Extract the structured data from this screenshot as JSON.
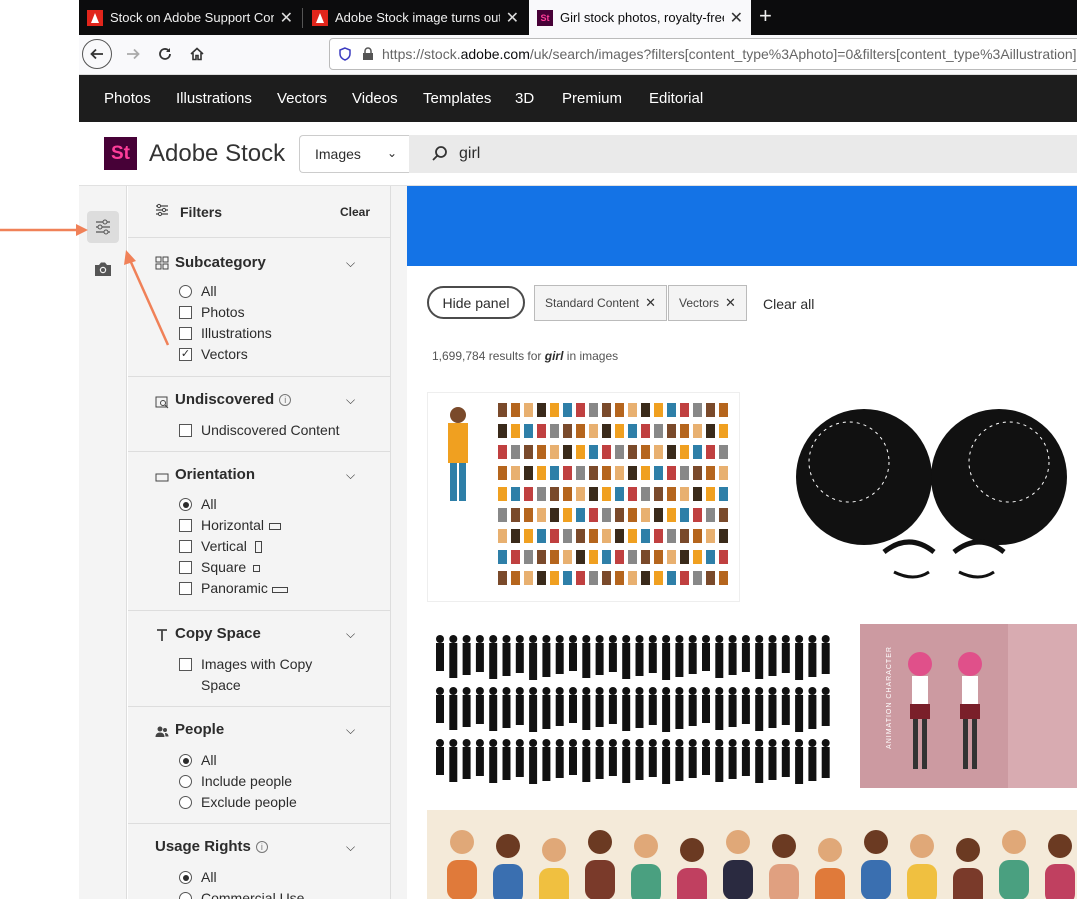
{
  "browser": {
    "tabs": [
      {
        "title": "Stock on Adobe Support Comm",
        "icon": "adobe-icon",
        "active": false
      },
      {
        "title": "Adobe Stock image turns out N",
        "icon": "adobe-icon",
        "active": false
      },
      {
        "title": "Girl stock photos, royalty-free i",
        "icon": "adobe-stock-icon",
        "active": true
      }
    ],
    "new_tab": "+",
    "url_prefix": "https://stock.",
    "url_domain": "adobe.com",
    "url_rest": "/uk/search/images?filters[content_type%3Aphoto]=0&filters[content_type%3Aillustration]"
  },
  "top_menu": [
    "Photos",
    "Illustrations",
    "Vectors",
    "Videos",
    "Templates",
    "3D",
    "Premium",
    "Editorial"
  ],
  "header": {
    "logo_text": "St",
    "brand": "Adobe Stock",
    "type_select": "Images",
    "search_value": "girl"
  },
  "filters": {
    "title": "Filters",
    "clear": "Clear",
    "sections": {
      "subcategory": {
        "title": "Subcategory",
        "options": [
          "All",
          "Photos",
          "Illustrations",
          "Vectors"
        ]
      },
      "undiscovered": {
        "title": "Undiscovered",
        "options": [
          "Undiscovered Content"
        ]
      },
      "orientation": {
        "title": "Orientation",
        "options": [
          "All",
          "Horizontal",
          "Vertical",
          "Square",
          "Panoramic"
        ]
      },
      "copy_space": {
        "title": "Copy Space",
        "options": [
          "Images with Copy Space"
        ]
      },
      "people": {
        "title": "People",
        "options": [
          "All",
          "Include people",
          "Exclude people"
        ]
      },
      "usage_rights": {
        "title": "Usage Rights",
        "options": [
          "All",
          "Commercial Use"
        ]
      }
    }
  },
  "main": {
    "hide_panel": "Hide panel",
    "chips": [
      "Standard Content",
      "Vectors"
    ],
    "clear_all": "Clear all",
    "results_count": "1,699,784",
    "results_mid": "results for",
    "results_query": "girl",
    "results_suffix": "in images",
    "thumb_char_label": "ANIMATION CHARACTER"
  },
  "colors": {
    "banner": "#1473e6",
    "annotation_arrow": "#f08158",
    "stock_logo_bg": "#470137",
    "stock_logo_fg": "#ff3d9a"
  }
}
